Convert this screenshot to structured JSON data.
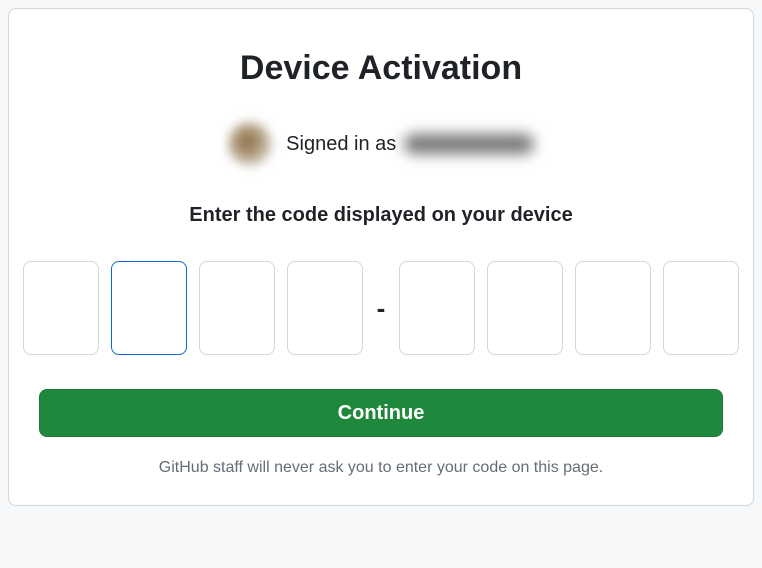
{
  "title": "Device Activation",
  "signed_in_label": "Signed in as",
  "instruction": "Enter the code displayed on your device",
  "code": {
    "segments": [
      "",
      "",
      "",
      "",
      "",
      "",
      "",
      ""
    ],
    "separator": "-"
  },
  "continue_label": "Continue",
  "footer_note": "GitHub staff will never ask you to enter your code on this page.",
  "colors": {
    "primary_button": "#1f883d",
    "focus_border": "#0969da",
    "border": "#d0d7de",
    "text": "#1f2328",
    "muted": "#656d76"
  }
}
